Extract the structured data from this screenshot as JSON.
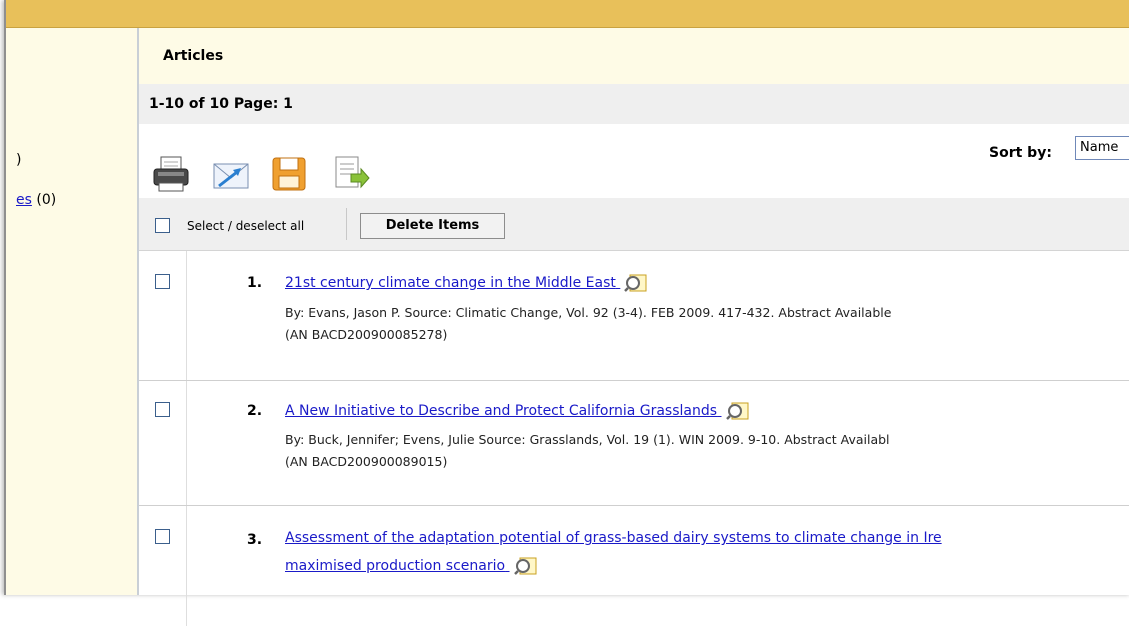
{
  "left": {
    "item1_text": ")",
    "item2_link": "es",
    "item2_count": "(0)"
  },
  "header": {
    "title": "Articles",
    "paging": "1-10 of 10  Page: 1"
  },
  "toolbar": {
    "icons": [
      "printer-icon",
      "email-icon",
      "save-icon",
      "export-icon"
    ],
    "sort_label": "Sort by:",
    "sort_value": "Name"
  },
  "selectbar": {
    "select_all_label": "Select / deselect all",
    "delete_label": "Delete Items"
  },
  "results": [
    {
      "number": "1.",
      "title": "21st century climate change in the Middle East",
      "meta_line1": "By: Evans, Jason P. Source: Climatic Change, Vol. 92 (3-4). FEB 2009. 417-432. Abstract Available",
      "meta_line2": "(AN BACD200900085278)"
    },
    {
      "number": "2.",
      "title": "A New Initiative to Describe and Protect California Grasslands",
      "meta_line1": "By: Buck, Jennifer; Evens, Julie Source: Grasslands, Vol. 19 (1). WIN 2009. 9-10. Abstract Availabl",
      "meta_line2": "(AN BACD200900089015)"
    },
    {
      "number": "3.",
      "title": "Assessment of the adaptation potential of grass-based dairy systems to climate change in Ire",
      "title_line2": "maximised production scenario"
    }
  ],
  "colors": {
    "topbar": "#e8c05a",
    "panel": "#fefbe6",
    "link": "#1a1ac8"
  }
}
